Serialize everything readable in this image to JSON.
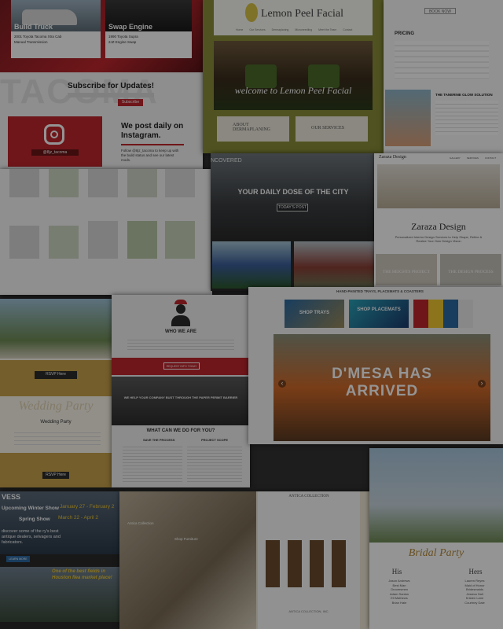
{
  "truck": {
    "cards": [
      {
        "title": "Build Truck",
        "sub1": "2001 Toyota Tacoma Xtra Cab",
        "sub2": "Manual Transmission"
      },
      {
        "title": "Swap Engine",
        "sub1": "1990 Toyota Supra",
        "sub2": "2JZ Engine Swap"
      }
    ],
    "subscribe": "Subscribe for Updates!",
    "subscribe_button": "Subscribe",
    "insta_handle": "@8jz_tacoma",
    "insta_title": "We post daily on Instagram.",
    "insta_body": "Follow @8jz_tacoma to keep up with the build status and see our latest mods."
  },
  "lemon": {
    "title": "Lemon Peel Facial",
    "nav": [
      "Home",
      "Our Services",
      "Dermaplaning",
      "Microneedling",
      "Meet the Team",
      "Contact"
    ],
    "hero_caption": "welcome to Lemon Peel Facial",
    "card_left": "ABOUT DERMAPLANING",
    "card_right": "OUR SERVICES"
  },
  "pricing": {
    "heading": "PRICING",
    "button": "BOOK NOW",
    "solution": "THE TANERINE GLOW SOLUTION"
  },
  "city": {
    "brand": "NCOVERED",
    "headline": "YOUR DAILY DOSE OF THE CITY",
    "button": "TODAY'S POST"
  },
  "zaraza": {
    "logo": "Zaraza Design",
    "nav": [
      "GALLERY",
      "SERVICES",
      "CONTACT"
    ],
    "title": "Zaraza Design",
    "tagline": "Personalized Interior Design Services to Help Shape, Refine & Realize Your Own Design Vision",
    "card_left": "THE HEIGHTS PROJECT",
    "card_right": "THE DESIGN PROCESS"
  },
  "wedding": {
    "rsvp": "RSVP Here",
    "rsvp_bottom": "RSVP Here",
    "party": "Wedding Party",
    "party_script": "Wedding Party"
  },
  "who": {
    "heading": "WHO WE ARE",
    "button": "REQUEST INFO TODAY",
    "banner": "WE HELP YOUR COMPANY BUST THROUGH THE PAPER PERMIT BARRIER",
    "section": "WHAT CAN WE DO FOR YOU?",
    "col_left": "SAVE THE PROCESS",
    "col_right": "PROJECT SCOPE"
  },
  "dmesa": {
    "topline": "HAND-PAINTED TRAYS, PLACEMATS & COASTERS",
    "shop_trays": "SHOP TRAYS",
    "shop_placemats": "SHOP PLACEMATS",
    "headline1": "D'MESA HAS",
    "headline2": "ARRIVED",
    "prev": "‹",
    "next": "›"
  },
  "market": {
    "brand": "VESS",
    "winter": "Upcoming Winter Show",
    "winter_dates": "January 27 - February 2",
    "spring": "Spring Show",
    "spring_dates": "March 22 - April 2",
    "body": "discover some of the ry's best antique dealers, selvagers and fabricators.",
    "button": "LEARN MORE",
    "quote": "One of the best fields in Houston flea market place!"
  },
  "antique": {
    "brand": "ANTICA COLLECTION",
    "caption1": "Antica Collection",
    "caption2": "Shop Furniture",
    "footer": "ANTICA COLLECTION, INC."
  },
  "bridal": {
    "script_title": "Bridal Party",
    "his": "His",
    "hers": "Hers",
    "his_names": [
      "Jason Andrews",
      "Best Man",
      "Groomsmen",
      "Adam Santos",
      "Eli Mathews",
      "Brian Hale"
    ],
    "hers_names": [
      "Lauren Reyes",
      "Maid of Honor",
      "Bridesmaids",
      "Jessica Hall",
      "Kristen Lane",
      "Courtney Dale"
    ]
  },
  "colors": {
    "red": "#c0272d",
    "gold": "#c9a24a",
    "lemon_green": "#8b8f3a",
    "sky": "#9ec3d8"
  }
}
